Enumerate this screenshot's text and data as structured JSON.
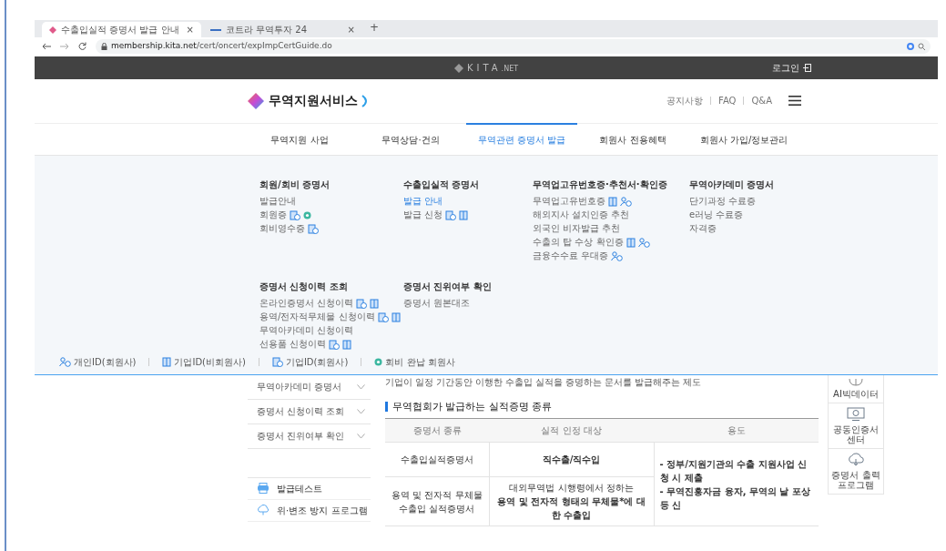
{
  "browser": {
    "tabs": [
      {
        "title": "수출입실적 증명서 발급 안내",
        "close": "×",
        "selected": true,
        "kind": "kita"
      },
      {
        "title": "코트라 무역투자 24",
        "close": "×",
        "selected": false,
        "kind": "kotra"
      }
    ],
    "new_tab": "+",
    "url_host": "membership.kita.net",
    "url_path": "/cert/oncert/expImpCertGuide.do"
  },
  "topbar": {
    "logo": "KITA",
    "logo_suffix": ".NET",
    "login": "로그인"
  },
  "header": {
    "site_title": "무역지원서비스",
    "links": [
      "공지사항",
      "FAQ",
      "Q&A"
    ]
  },
  "nav": [
    {
      "label": "무역지원 사업",
      "selected": false
    },
    {
      "label": "무역상담·건의",
      "selected": false
    },
    {
      "label": "무역관련 증명서 발급",
      "selected": true
    },
    {
      "label": "회원사 전용혜택",
      "selected": false
    },
    {
      "label": "회원사 가입/정보관리",
      "selected": false
    }
  ],
  "mega_menu": {
    "rows": [
      [
        {
          "title": "회원/회비 증명서",
          "items": [
            {
              "label": "발급안내",
              "selected": false
            },
            {
              "label": "회원증",
              "selected": false,
              "corp_member": true,
              "paid": true
            },
            {
              "label": "회비영수증",
              "selected": false,
              "corp_member": true
            }
          ]
        },
        {
          "title": "수출입실적 증명서",
          "items": [
            {
              "label": "발급 안내",
              "selected": true
            },
            {
              "label": "발급 신청",
              "selected": false,
              "corp_member": true,
              "corp_nonmember": true
            }
          ]
        },
        {
          "title": "무역업고유번호증·추천서·확인증",
          "items": [
            {
              "label": "무역업고유번호증",
              "selected": false,
              "corp_nonmember": true,
              "personal": true
            },
            {
              "label": "해외지사 설치인증 추천",
              "selected": false
            },
            {
              "label": "외국인 비자발급 추천",
              "selected": false
            },
            {
              "label": "수출의 탑 수상 확인증",
              "selected": false,
              "corp_nonmember": true,
              "personal": true
            },
            {
              "label": "금융수수료 우대증",
              "selected": false,
              "personal": true
            }
          ]
        },
        {
          "title": "무역아카데미 증명서",
          "items": [
            {
              "label": "단기과정 수료증",
              "selected": false
            },
            {
              "label": "e러닝 수료증",
              "selected": false
            },
            {
              "label": "자격증",
              "selected": false
            }
          ]
        }
      ],
      [
        {
          "title": "증명서 신청이력 조회",
          "items": [
            {
              "label": "온라인증명서 신청이력",
              "selected": false,
              "corp_member": true,
              "corp_nonmember": true
            },
            {
              "label": "용역/전자적무체물 신청이력",
              "selected": false,
              "corp_member": true,
              "corp_nonmember": true
            },
            {
              "label": "무역아카데미 신청이력",
              "selected": false
            },
            {
              "label": "선용품 신청이력",
              "selected": false,
              "corp_member": true,
              "corp_nonmember": true
            }
          ]
        },
        {
          "title": "증명서 진위여부 확인",
          "items": [
            {
              "label": "증명서 원본대조",
              "selected": false
            }
          ]
        }
      ]
    ],
    "legend": [
      {
        "kind": "personal",
        "label": "개인ID(회원사)"
      },
      {
        "kind": "corp-nonmember",
        "label": "기업ID(비회원사)"
      },
      {
        "kind": "corp-member",
        "label": "기업ID(회원사)"
      },
      {
        "kind": "paid",
        "label": "회비 완납 회원사"
      }
    ]
  },
  "sidebar": {
    "items": [
      {
        "label": "무역아카데미 증명서",
        "expanded": false
      },
      {
        "label": "증명서 신청이력 조회",
        "expanded": false
      },
      {
        "label": "증명서 진위여부 확인",
        "expanded": false
      }
    ],
    "tools": [
      {
        "label": "발급테스트",
        "kind": "printer"
      },
      {
        "label": "위·변조 방지 프로그램",
        "kind": "cloud"
      }
    ]
  },
  "content": {
    "intro": "기업이 일정 기간동안 이행한 수출입 실적을 증명하는 문서를 발급해주는 제도",
    "heading": "무역협회가 발급하는 실적증명 종류",
    "table": {
      "columns": [
        "증명서 종류",
        "실적 인정 대상",
        "용도"
      ],
      "rows": [
        {
          "cells": [
            {
              "lines": [
                "수출입실적증명서"
              ],
              "bold": [
                false
              ]
            },
            {
              "lines": [
                "직수출/직수입"
              ],
              "bold": [
                true
              ]
            }
          ]
        },
        {
          "cells": [
            {
              "lines": [
                "용역 및 전자적 무체물 수출입 실적증명서"
              ],
              "bold": [
                false
              ]
            },
            {
              "lines": [
                "대외무역법 시행령에서 정하는",
                "용역 및 전자적 형태의 무체물*에 대한 수출입"
              ],
              "bold": [
                false,
                true
              ]
            }
          ]
        }
      ],
      "usage": {
        "lines": [
          "- 정부/지원기관의 수출 지원사업 신청 시 제출",
          "- 무역진흥자금 융자, 무역의 날 포상 등 신"
        ],
        "bold": [
          true,
          true
        ]
      }
    }
  },
  "quick_menu": [
    {
      "label": "AI빅데이터",
      "kind": "ai"
    },
    {
      "label": "공동인증서 센터",
      "kind": "monitor"
    },
    {
      "label": "증명서 출력 프로그램",
      "kind": "cloud-download"
    }
  ]
}
